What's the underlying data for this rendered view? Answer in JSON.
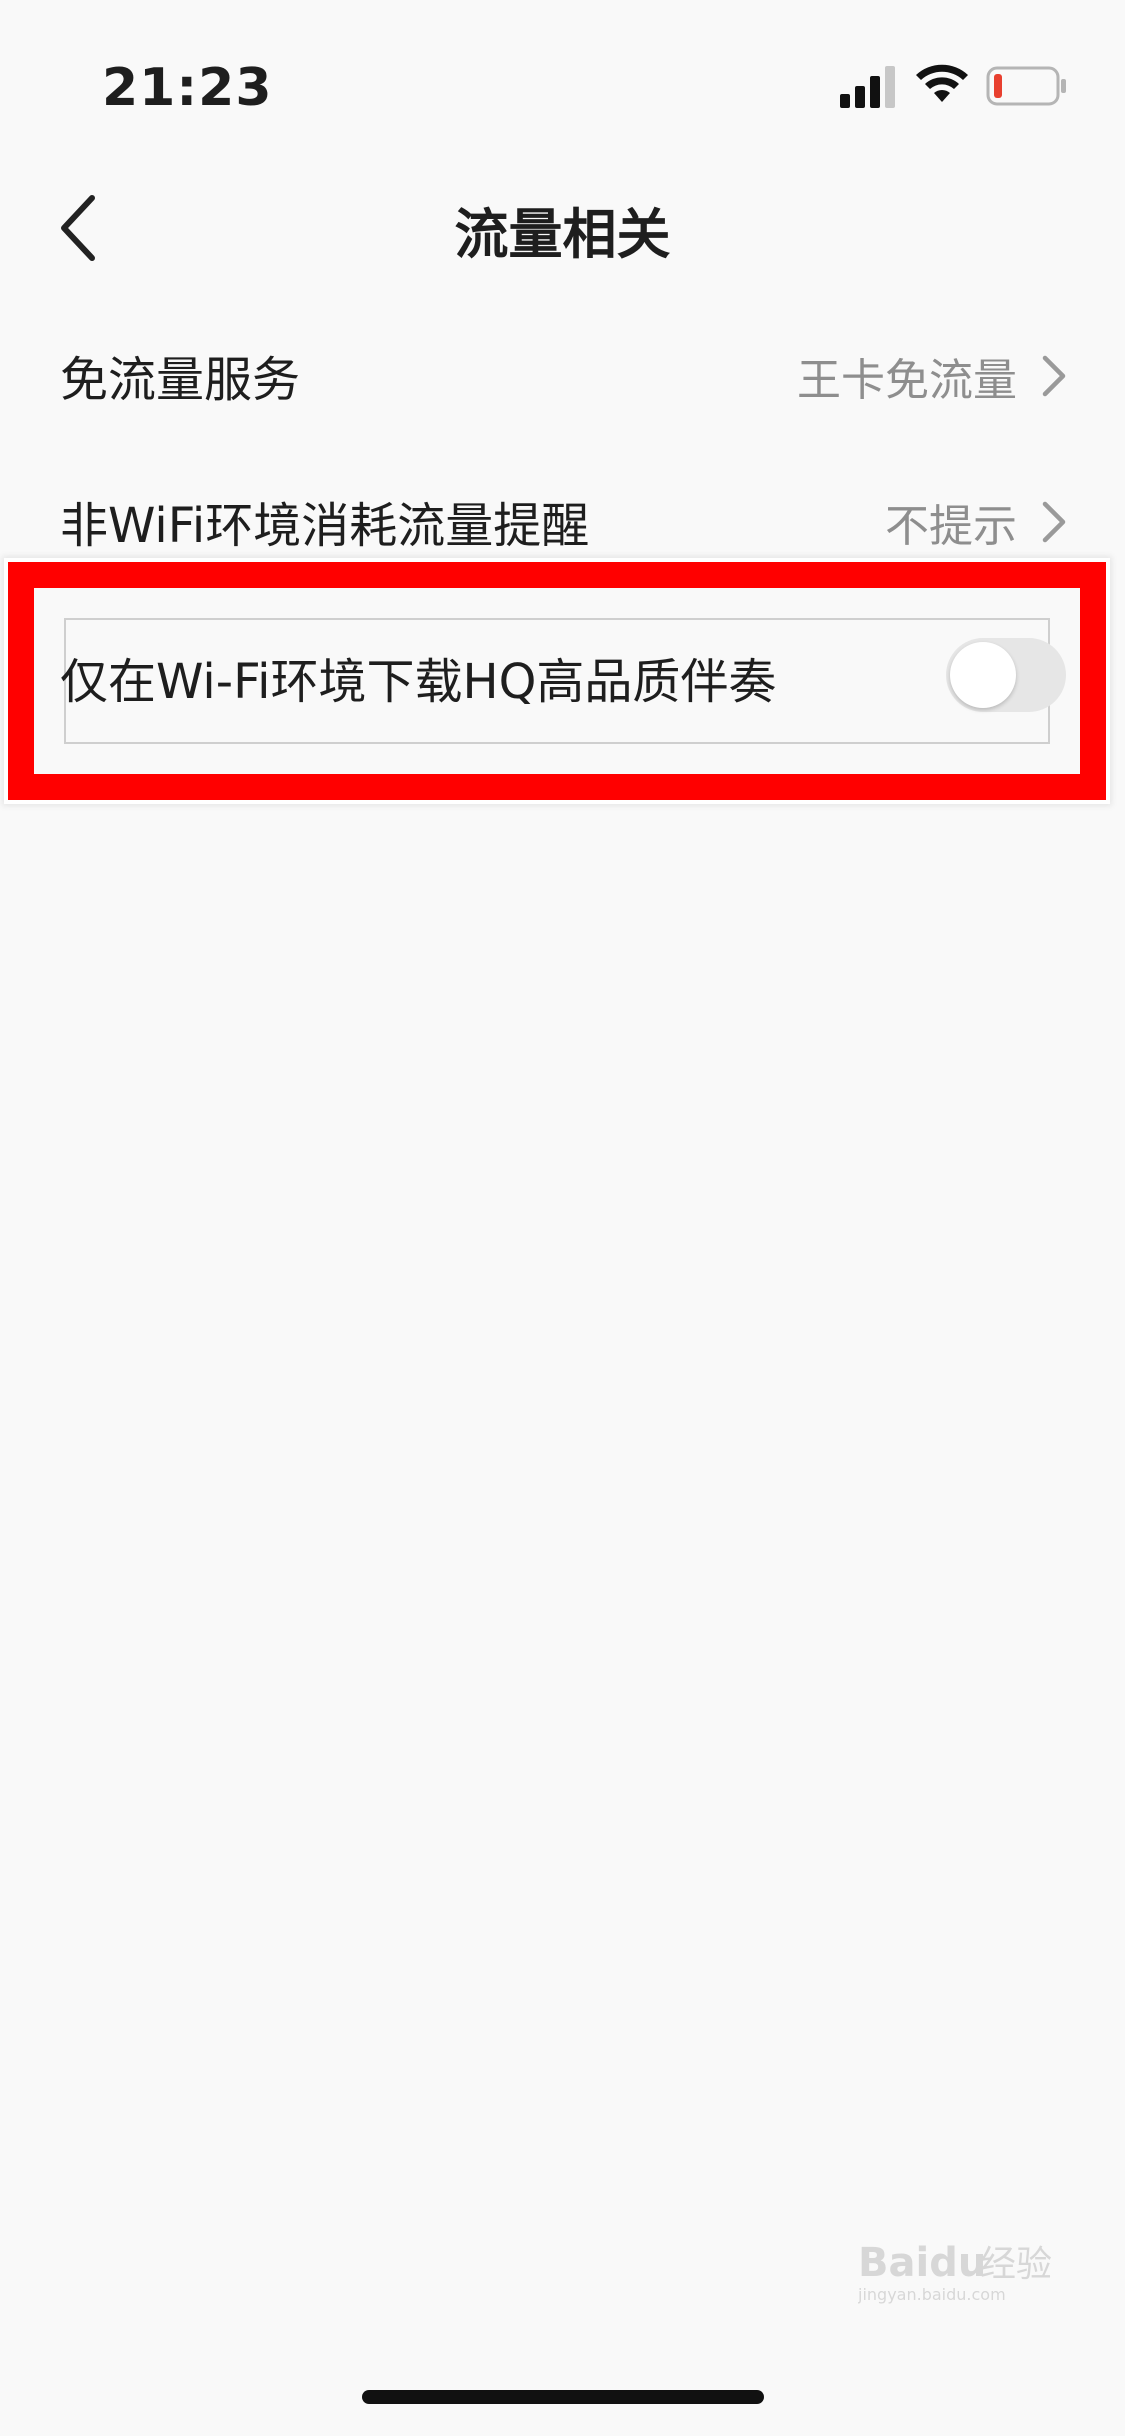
{
  "status_bar": {
    "time": "21:23",
    "icons": [
      "signal-icon",
      "wifi-icon",
      "battery-low-icon"
    ],
    "battery_color": "#e8402f"
  },
  "nav": {
    "back_icon": "chevron-left-icon",
    "title": "流量相关"
  },
  "settings": [
    {
      "label": "免流量服务",
      "value": "王卡免流量",
      "icon": "chevron-right-icon"
    },
    {
      "label": "非WiFi环境消耗流量提醒",
      "value": "不提示",
      "icon": "chevron-right-icon"
    }
  ],
  "toggle_setting": {
    "label": "仅在Wi-Fi环境下载HQ高品质伴奏",
    "enabled": false
  },
  "highlight_color": "#ff0000",
  "watermark": {
    "brand": "Baidu",
    "suffix": "经验",
    "url": "jingyan.baidu.com"
  }
}
